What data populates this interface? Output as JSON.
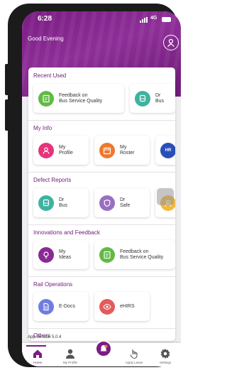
{
  "status_bar": {
    "time": "6:28",
    "network": "4G"
  },
  "header": {
    "greeting": "Good Evening"
  },
  "colors": {
    "brand": "#7b1c84",
    "accent_pink": "#e6337a",
    "accent_orange": "#f0782d",
    "accent_teal": "#3db3a0",
    "accent_green": "#62b946",
    "accent_purple": "#9a6fc0"
  },
  "sections": {
    "recent_used": {
      "title": "Recent Used",
      "tiles": [
        {
          "label": "Feedback on\nBus Service Quality",
          "icon": "feedback-icon"
        },
        {
          "label": "Dr\nBus",
          "icon": "bus-icon"
        }
      ]
    },
    "my_info": {
      "title": "My Info",
      "tiles": [
        {
          "label": "My\nProfile",
          "icon": "profile-icon"
        },
        {
          "label": "My\nRoster",
          "icon": "calendar-icon"
        },
        {
          "label": "HR",
          "icon": "hr-logo-icon"
        }
      ]
    },
    "defect_reports": {
      "title": "Defect Reports",
      "tiles": [
        {
          "label": "Dr\nBus",
          "icon": "bus-icon"
        },
        {
          "label": "Dr\nSafe",
          "icon": "shield-icon"
        },
        {
          "label": "",
          "icon": "person-icon"
        }
      ]
    },
    "innovations": {
      "title": "Innovations and Feedback",
      "tiles": [
        {
          "label": "My\nIdeas",
          "icon": "lightbulb-icon"
        },
        {
          "label": "Feedback on\nBus Service Quality",
          "icon": "feedback-icon"
        }
      ]
    },
    "rail_operations": {
      "title": "Rail Operations",
      "tiles": [
        {
          "label": "E-Docs",
          "icon": "document-icon"
        },
        {
          "label": "eHIRS",
          "icon": "eye-icon"
        }
      ]
    },
    "others": {
      "title": "Others"
    }
  },
  "app_version": "App Version 5.0.4",
  "bottom_nav": [
    {
      "label": "Home",
      "icon": "home-icon"
    },
    {
      "label": "My Profile",
      "icon": "user-icon"
    },
    {
      "label": "",
      "icon": "notification-fab-icon"
    },
    {
      "label": "Apply Leave",
      "icon": "hand-icon"
    },
    {
      "label": "Settings",
      "icon": "gear-icon"
    }
  ]
}
